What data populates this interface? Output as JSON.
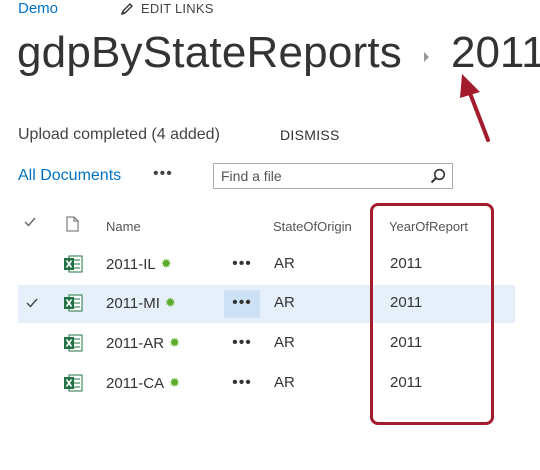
{
  "header": {
    "site_link": "Demo",
    "edit_links": "EDIT LINKS",
    "site_title": "gdpByStateReports",
    "library_title": "2011"
  },
  "status": {
    "message": "Upload completed (4 added)",
    "dismiss": "DISMISS"
  },
  "view": {
    "label": "All Documents",
    "more": "•••",
    "search_placeholder": "Find a file"
  },
  "table": {
    "headers": {
      "check": "✓",
      "name": "Name",
      "state": "StateOfOrigin",
      "year": "YearOfReport"
    },
    "rows": [
      {
        "name": "2011-IL",
        "state": "AR",
        "year": "2011",
        "selected": false
      },
      {
        "name": "2011-MI",
        "state": "AR",
        "year": "2011",
        "selected": true
      },
      {
        "name": "2011-AR",
        "state": "AR",
        "year": "2011",
        "selected": false
      },
      {
        "name": "2011-CA",
        "state": "AR",
        "year": "2011",
        "selected": false
      }
    ],
    "more_glyph": "•••",
    "new_glyph": "✹",
    "check_glyph": "✓"
  },
  "colors": {
    "link": "#0072c6",
    "selected_row": "#e6f0fa",
    "excel_green": "#217346",
    "new_green": "#5bab28",
    "annotation_red": "#a31c2e"
  }
}
